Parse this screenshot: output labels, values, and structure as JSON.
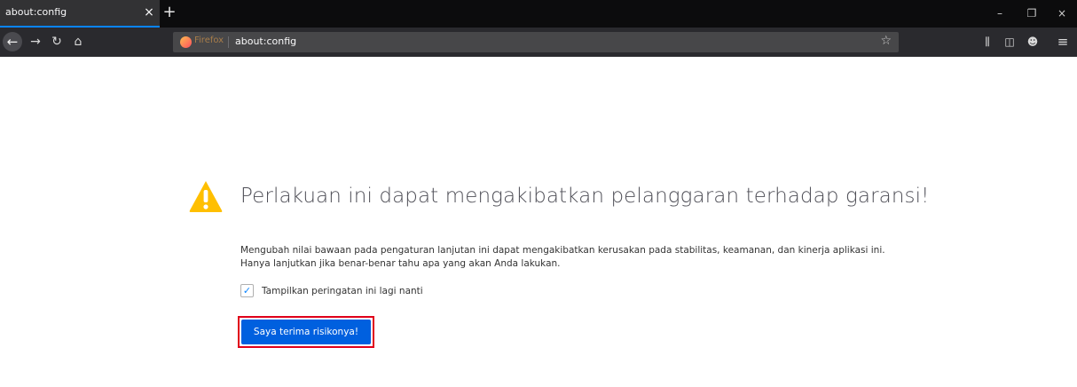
{
  "tab": {
    "title": "about:config",
    "close_glyph": "×",
    "new_tab_glyph": "+"
  },
  "window_controls": {
    "minimize": "–",
    "restore": "❐",
    "close": "×"
  },
  "navbar": {
    "back_glyph": "←",
    "forward_glyph": "→",
    "reload_glyph": "↻",
    "home_glyph": "⌂",
    "identity_label": "Firefox",
    "url": "about:config",
    "bookmark_glyph": "☆",
    "library_glyph": "⫼",
    "sidebar_glyph": "◫",
    "account_glyph": "☻",
    "menu_glyph": "≡"
  },
  "warning": {
    "title": "Perlakuan ini dapat mengakibatkan pelanggaran terhadap garansi!",
    "description_line1": "Mengubah nilai bawaan pada pengaturan lanjutan ini dapat mengakibatkan kerusakan pada stabilitas, keamanan, dan kinerja aplikasi ini.",
    "description_line2": "Hanya lanjutkan jika benar-benar tahu apa yang akan Anda lakukan.",
    "checkbox_label": "Tampilkan peringatan ini lagi nanti",
    "checkbox_checked": true,
    "checkbox_glyph": "✓",
    "accept_button": "Saya terima risikonya!"
  },
  "colors": {
    "accent": "#0060df",
    "highlight_outline": "#e0001a",
    "warning_icon": "#ffbf00"
  },
  "icons": [
    "back-arrow-icon",
    "forward-arrow-icon",
    "reload-icon",
    "home-icon",
    "firefox-logo-icon",
    "bookmark-star-icon",
    "library-icon",
    "sidebar-icon",
    "account-icon",
    "hamburger-menu-icon",
    "warning-triangle-icon",
    "checkmark-icon"
  ]
}
